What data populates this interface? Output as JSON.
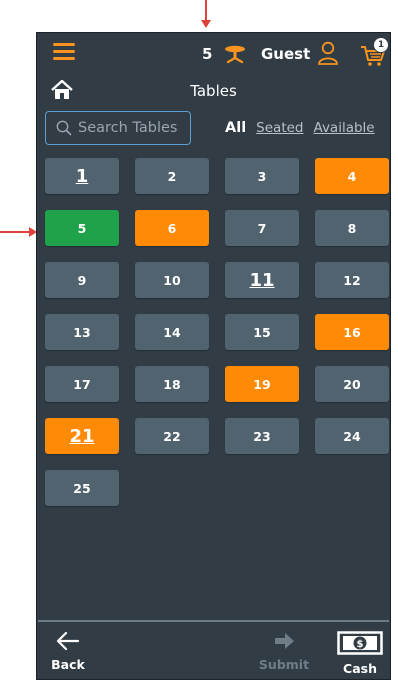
{
  "topbar": {
    "table_count": "5",
    "guest_label": "Guest",
    "cart_count": "1"
  },
  "page": {
    "title": "Tables"
  },
  "search": {
    "placeholder": "Search Tables"
  },
  "filters": {
    "all": "All",
    "seated": "Seated",
    "available": "Available"
  },
  "tables": [
    {
      "label": "1",
      "status": "default",
      "highlight": true
    },
    {
      "label": "2",
      "status": "default",
      "highlight": false
    },
    {
      "label": "3",
      "status": "default",
      "highlight": false
    },
    {
      "label": "4",
      "status": "orange",
      "highlight": false
    },
    {
      "label": "5",
      "status": "green",
      "highlight": false
    },
    {
      "label": "6",
      "status": "orange",
      "highlight": false
    },
    {
      "label": "7",
      "status": "default",
      "highlight": false
    },
    {
      "label": "8",
      "status": "default",
      "highlight": false
    },
    {
      "label": "9",
      "status": "default",
      "highlight": false
    },
    {
      "label": "10",
      "status": "default",
      "highlight": false
    },
    {
      "label": "11",
      "status": "default",
      "highlight": true
    },
    {
      "label": "12",
      "status": "default",
      "highlight": false
    },
    {
      "label": "13",
      "status": "default",
      "highlight": false
    },
    {
      "label": "14",
      "status": "default",
      "highlight": false
    },
    {
      "label": "15",
      "status": "default",
      "highlight": false
    },
    {
      "label": "16",
      "status": "orange",
      "highlight": false
    },
    {
      "label": "17",
      "status": "default",
      "highlight": false
    },
    {
      "label": "18",
      "status": "default",
      "highlight": false
    },
    {
      "label": "19",
      "status": "orange",
      "highlight": false
    },
    {
      "label": "20",
      "status": "default",
      "highlight": false
    },
    {
      "label": "21",
      "status": "orange",
      "highlight": true
    },
    {
      "label": "22",
      "status": "default",
      "highlight": false
    },
    {
      "label": "23",
      "status": "default",
      "highlight": false
    },
    {
      "label": "24",
      "status": "default",
      "highlight": false
    },
    {
      "label": "25",
      "status": "default",
      "highlight": false
    }
  ],
  "bottom": {
    "back": "Back",
    "submit": "Submit",
    "cash": "Cash"
  },
  "icons": {
    "menu": "hamburger-menu-icon",
    "table": "table-icon",
    "user": "user-icon",
    "cart": "cart-icon",
    "home": "home-icon",
    "search": "search-icon",
    "back": "arrow-left-icon",
    "submit": "arrow-right-icon",
    "cash": "cash-icon"
  },
  "colors": {
    "background": "#313c45",
    "tile_default": "#51636f",
    "tile_orange": "#ff8a06",
    "tile_green": "#1fa24a",
    "accent": "#f7931e",
    "annotation_arrow": "#e0413a"
  }
}
